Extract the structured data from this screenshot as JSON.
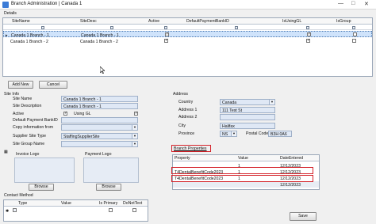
{
  "window": {
    "title": "Branch Administration | Canada 1",
    "minimize": "—",
    "maximize": "□",
    "close": "✕"
  },
  "details_label": "Details",
  "branch_grid": {
    "columns": [
      "SiteName",
      "SiteDesc",
      "Active",
      "DefaultPaymentBankID",
      "IsUsingGL",
      "IsGroup"
    ],
    "rows": [
      {
        "site_name": "Canada 1 Branch - 1",
        "site_desc": "Canada 1 Branch - 1",
        "active": true,
        "is_using_gl": true,
        "is_group": false
      },
      {
        "site_name": "Canada 1 Branch - 2",
        "site_desc": "Canada 1 Branch - 2",
        "active": true,
        "is_using_gl": true,
        "is_group": false
      }
    ]
  },
  "buttons": {
    "add_new": "Add New",
    "cancel": "Cancel",
    "browse": "Browse",
    "save": "Save"
  },
  "site_info": {
    "title": "Site Info",
    "site_name_label": "Site Name",
    "site_name": "Canada 1 Branch - 1",
    "site_desc_label": "Site Description",
    "site_desc": "Canada 1 Branch - 1",
    "active_label": "Active",
    "using_gl": "Using GL",
    "default_bank_label": "Default Payment BankID",
    "copy_info_label": "Copy information from",
    "supplier_type_label": "Supplier Site Type",
    "supplier_type": "StaffingSupplierSite",
    "site_group_label": "Site Group Name",
    "invoice_logo": "Invoice Logo",
    "payment_logo": "Payment Logo"
  },
  "address": {
    "title": "Address",
    "country_label": "Country",
    "country": "Canada",
    "address1_label": "Address 1",
    "address1": "111 Test St",
    "address2_label": "Address 2",
    "city_label": "City",
    "city": "Halifax",
    "province_label": "Province",
    "province": "NS",
    "postal_code_label": "Postal Code",
    "postal_code": "B3H 0A6"
  },
  "branch_properties": {
    "title": "Branch Properties",
    "columns": [
      "Property",
      "Value",
      "DateEntered"
    ],
    "rows": [
      {
        "property": "",
        "value": "1",
        "date": "12/12/2023"
      },
      {
        "property": "T4DentalBenefitCode2023",
        "value": "1",
        "date": "12/12/2023"
      },
      {
        "property": "T4DentalBenefitCode2023",
        "value": "1",
        "date": "12/12/2023"
      },
      {
        "property": "",
        "value": "",
        "date": "12/12/2023"
      }
    ]
  },
  "contact_method": {
    "title": "Contact Method",
    "columns": [
      "Type",
      "Value",
      "Is Primary",
      "DoNotText"
    ]
  },
  "colors": {
    "accent": "#3b7bd6",
    "highlight": "#d4222a",
    "selection": "#cfe3fb"
  }
}
